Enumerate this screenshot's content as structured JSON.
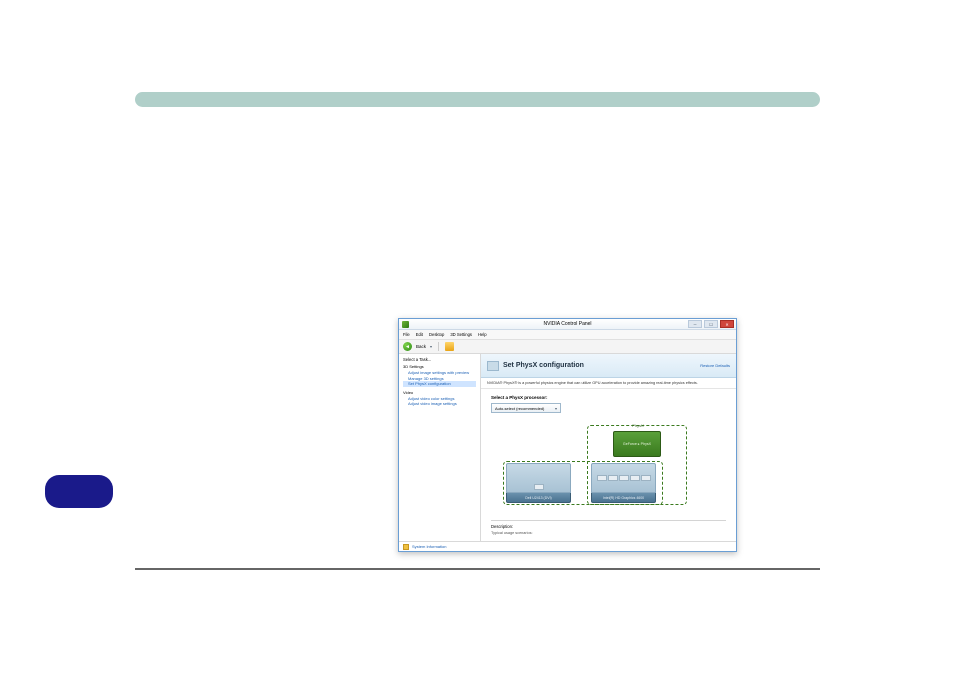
{
  "window": {
    "title": "NVIDIA Control Panel",
    "menubar": [
      "File",
      "Edit",
      "Desktop",
      "3D Settings",
      "Help"
    ],
    "toolbar": {
      "back": "Back"
    },
    "footer": "System Information"
  },
  "sidebar": {
    "heading": "Select a Task...",
    "groups": [
      {
        "title": "3D Settings",
        "items": [
          "Adjust image settings with preview",
          "Manage 3D settings",
          "Set PhysX configuration"
        ],
        "active": 2
      },
      {
        "title": "Video",
        "items": [
          "Adjust video color settings",
          "Adjust video image settings"
        ],
        "active": -1
      }
    ]
  },
  "main": {
    "title": "Set PhysX configuration",
    "restore": "Restore Defaults",
    "strip": "NVIDIA® PhysX® is a powerful physics engine that can utilize GPU acceleration to provide amazing real-time physics effects.",
    "selectLabel": "Select a PhysX processor:",
    "dropdown": "Auto-select (recommended)",
    "physxLabel": "PhysX",
    "gpuName": "GeForce ▸ PhysX",
    "monitor1": "Dell U2413 (DVI)",
    "monitor2": "Intel(R) HD Graphics 4600",
    "descTitle": "Description:",
    "descSub": "Typical usage scenarios:"
  }
}
